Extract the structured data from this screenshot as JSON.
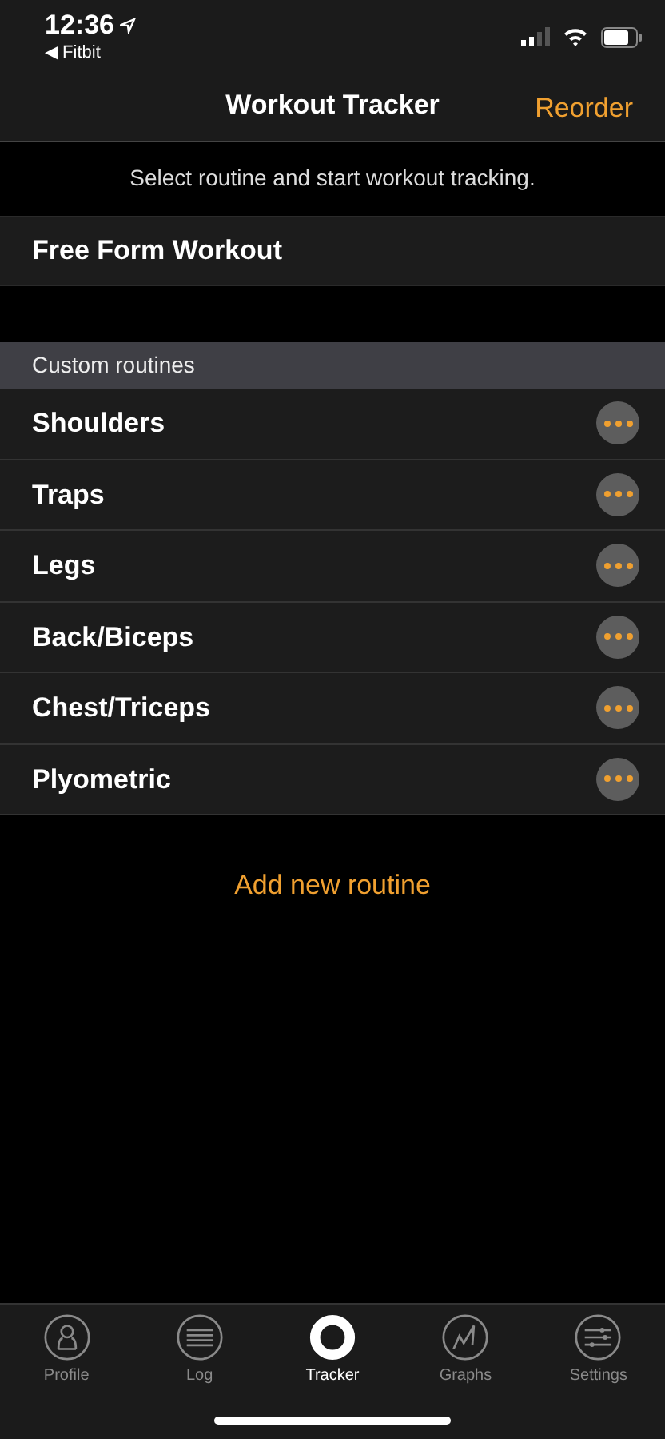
{
  "status_bar": {
    "time": "12:36",
    "back_app": "◀ Fitbit"
  },
  "nav": {
    "title": "Workout Tracker",
    "action": "Reorder"
  },
  "hint": "Select routine and start workout tracking.",
  "free_form": "Free Form Workout",
  "section_header": "Custom routines",
  "routines": [
    {
      "name": "Shoulders"
    },
    {
      "name": "Traps"
    },
    {
      "name": "Legs"
    },
    {
      "name": "Back/Biceps"
    },
    {
      "name": "Chest/Triceps"
    },
    {
      "name": "Plyometric"
    }
  ],
  "add_button": "Add new routine",
  "tabs": [
    {
      "label": "Profile",
      "selected": false
    },
    {
      "label": "Log",
      "selected": false
    },
    {
      "label": "Tracker",
      "selected": true
    },
    {
      "label": "Graphs",
      "selected": false
    },
    {
      "label": "Settings",
      "selected": false
    }
  ]
}
